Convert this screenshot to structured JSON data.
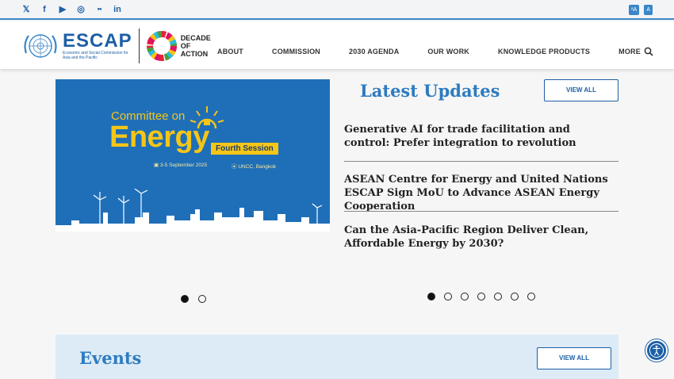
{
  "social": {
    "items": [
      {
        "name": "x-icon",
        "glyph": "𝕏"
      },
      {
        "name": "facebook-icon",
        "glyph": "f"
      },
      {
        "name": "youtube-icon",
        "glyph": "▶"
      },
      {
        "name": "instagram-icon",
        "glyph": "◎"
      },
      {
        "name": "flickr-icon",
        "glyph": "●●"
      },
      {
        "name": "linkedin-icon",
        "glyph": "in"
      }
    ]
  },
  "language": {
    "translate": "ᵃA",
    "text_size": "A"
  },
  "logo": {
    "name": "ESCAP",
    "subtitle": "Economic and Social Commission for Asia and the Pacific",
    "decade": "DECADE OF ACTION"
  },
  "nav": {
    "items": [
      "ABOUT",
      "COMMISSION",
      "2030 AGENDA",
      "OUR WORK",
      "KNOWLEDGE PRODUCTS",
      "MORE"
    ]
  },
  "hero": {
    "line1": "Committee on",
    "line2": "Energy",
    "session": "Fourth Session",
    "date": "3-5 September 2025",
    "venue": "UNCC, Bangkok"
  },
  "updates": {
    "title": "Latest Updates",
    "view_all": "VIEW ALL",
    "items": [
      "Generative AI for trade facilitation and control: Prefer integration to revolution",
      "ASEAN Centre for Energy and United Nations ESCAP Sign MoU to Advance ASEAN Energy Cooperation",
      "Can the Asia-Pacific Region Deliver Clean, Affordable Energy by 2030?"
    ]
  },
  "events": {
    "title": "Events",
    "view_all": "VIEW ALL"
  },
  "colors": {
    "brand": "#1d5fa6",
    "accent": "#2e7bc0",
    "gold": "#f5c518"
  }
}
